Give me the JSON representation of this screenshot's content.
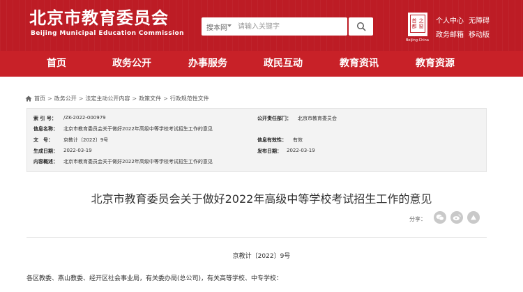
{
  "header": {
    "title": "北京市教育委员会",
    "subtitle": "Beijing Municipal Education Commission",
    "search": {
      "scope": "搜本网",
      "placeholder": "请输入关键字"
    },
    "seal": {
      "chars": [
        "首",
        "之",
        "都",
        "窗"
      ],
      "caption": "Beijing·China"
    },
    "user_links": {
      "personal_center": "个人中心",
      "accessibility": "无障碍",
      "gov_mail": "政务邮箱",
      "mobile": "移动版"
    }
  },
  "nav": {
    "items": [
      "首页",
      "政务公开",
      "办事服务",
      "政民互动",
      "教育资讯",
      "教育资源"
    ]
  },
  "breadcrumb": {
    "items": [
      "首页",
      "政务公开",
      "法定主动公开内容",
      "政策文件",
      "行政规范性文件"
    ],
    "separator": ">"
  },
  "meta": {
    "index_label": "索 引 号：",
    "index_value": "/ZK-2022-000979",
    "responsible_label": "公开责任部门：",
    "responsible_value": "北京市教育委员会",
    "info_name_label": "信息名称：",
    "info_name_value": "北京市教育委员会关于做好2022年高级中等学校考试招生工作的意见",
    "doc_no_label": "文　号：",
    "doc_no_value": "京教计〔2022〕9号",
    "validity_label": "信息有效性：",
    "validity_value": "有效",
    "created_label": "生成日期：",
    "created_value": "2022-03-19",
    "published_label": "发布日期：",
    "published_value": "2022-03-19",
    "summary_label": "内容概述：",
    "summary_value": "北京市教育委员会关于做好2022年高级中等学校考试招生工作的意见"
  },
  "article": {
    "title": "北京市教育委员会关于做好2022年高级中等学校考试招生工作的意见",
    "share_label": "分享：",
    "doc_number": "京教计〔2022〕9号",
    "body_first_line": "各区教委、燕山教委、经开区社会事业局，有关委办局(总公司)，有关高等学校、中专学校："
  },
  "colors": {
    "brand_red": "#bd1c25",
    "nav_red": "#c82128",
    "meta_bg": "#f3f3f3"
  }
}
